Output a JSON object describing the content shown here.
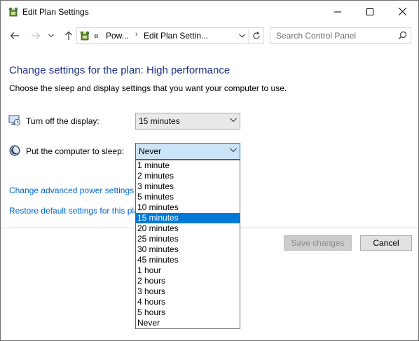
{
  "window": {
    "title": "Edit Plan Settings",
    "icons": {
      "app": "power-plan-icon",
      "minimize": "minimize-icon",
      "maximize": "maximize-icon",
      "close": "close-icon"
    }
  },
  "nav": {
    "back_icon": "back-arrow-icon",
    "forward_icon": "forward-arrow-icon",
    "recent_icon": "chevron-down-icon",
    "up_icon": "up-arrow-icon",
    "breadcrumb_overflow": "«",
    "breadcrumbs": [
      "Pow...",
      "Edit Plan Settin..."
    ],
    "breadcrumb_separator": "›",
    "search_placeholder": "Search Control Panel"
  },
  "main": {
    "heading": "Change settings for the plan: High performance",
    "subtitle": "Choose the sleep and display settings that you want your computer to use.",
    "display": {
      "label": "Turn off the display:",
      "value": "15 minutes",
      "icon": "monitor-clock-icon"
    },
    "sleep": {
      "label": "Put the computer to sleep:",
      "value": "Never",
      "icon": "moon-icon"
    },
    "links": {
      "advanced": "Change advanced power settings",
      "restore": "Restore default settings for this pla"
    },
    "buttons": {
      "save": "Save changes",
      "cancel": "Cancel"
    }
  },
  "dropdown": {
    "options": [
      "1 minute",
      "2 minutes",
      "3 minutes",
      "5 minutes",
      "10 minutes",
      "15 minutes",
      "20 minutes",
      "25 minutes",
      "30 minutes",
      "45 minutes",
      "1 hour",
      "2 hours",
      "3 hours",
      "4 hours",
      "5 hours",
      "Never"
    ],
    "highlighted": "15 minutes"
  },
  "colors": {
    "accent": "#0078d7",
    "heading": "#1e3287",
    "link": "#0066cc"
  }
}
